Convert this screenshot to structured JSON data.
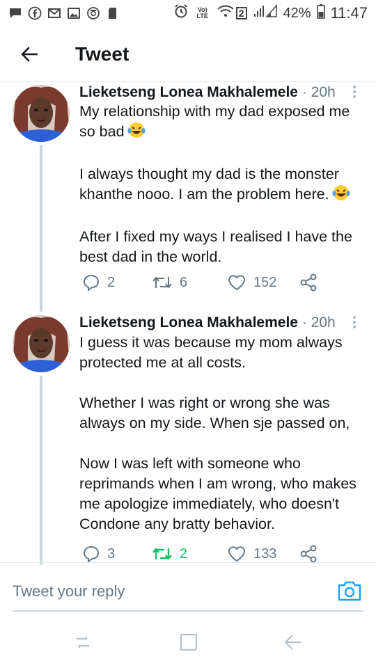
{
  "status_bar": {
    "network": "Vo) LTE",
    "sim_badge": "2",
    "battery": "42%",
    "time": "11:47",
    "icons": [
      "chat-icon",
      "facebook-icon",
      "gmail-icon",
      "gallery-icon",
      "camera-sync-icon",
      "sd-card-icon",
      "alarm-icon",
      "wifi-icon",
      "signal-icon",
      "battery-icon"
    ]
  },
  "header": {
    "title": "Tweet",
    "back_icon": "arrow-left-icon"
  },
  "tweets": [
    {
      "name": "Lieketseng Lonea Makhalemele",
      "dot": "·",
      "time": "20h",
      "paragraphs": [
        "My relationship with my dad exposed me so bad",
        "I always thought my dad is the monster khanthe nooo. I am the problem here.",
        "After I fixed my ways I realised I have the best dad in the world."
      ],
      "replies": "2",
      "retweets": "6",
      "likes": "152",
      "retweeted": false
    },
    {
      "name": "Lieketseng Lonea Makhalemele",
      "dot": "·",
      "time": "20h",
      "paragraphs": [
        "I guess it was because my mom always protected me at all costs.",
        "Whether I was right or wrong she was always on my side. When sje passed on,",
        "Now I was left with someone who reprimands when I am wrong, who makes me apologize immediately, who doesn't Condone any bratty behavior."
      ],
      "replies": "3",
      "retweets": "2",
      "likes": "133",
      "retweeted": true
    }
  ],
  "reply": {
    "placeholder": "Tweet your reply",
    "camera_icon": "camera-icon"
  },
  "colors": {
    "text": "#14171a",
    "muted": "#657786",
    "accent": "#1da1f2",
    "retweet_green": "#17bf63",
    "thread_line": "#ccd6dd"
  }
}
